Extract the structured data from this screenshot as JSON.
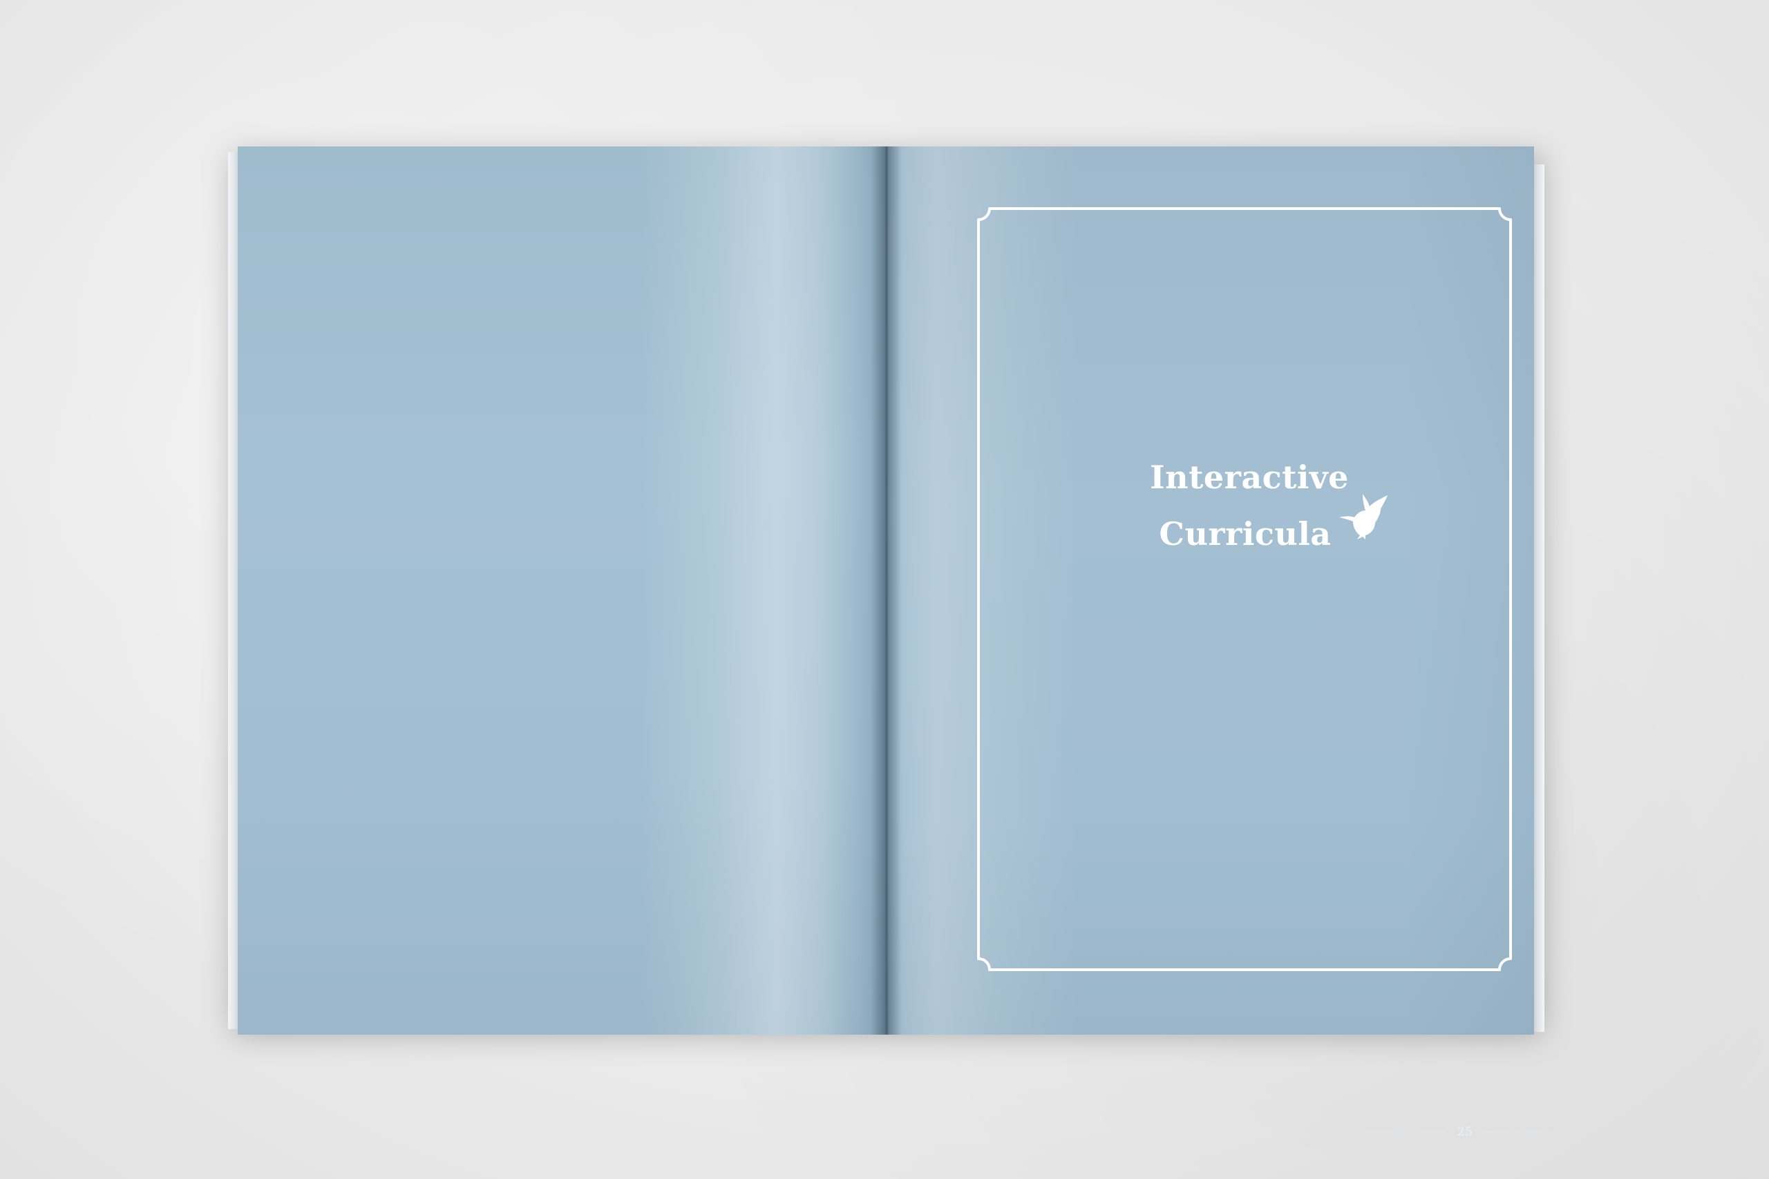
{
  "book": {
    "right_page": {
      "title_lines": [
        "Interactive",
        "Curricula"
      ],
      "title_icon": "hummingbird-icon",
      "page_number": "25"
    }
  },
  "colors": {
    "background": "#ebebeb",
    "page": "#a2bfd1",
    "frame_and_text": "#ffffff"
  }
}
